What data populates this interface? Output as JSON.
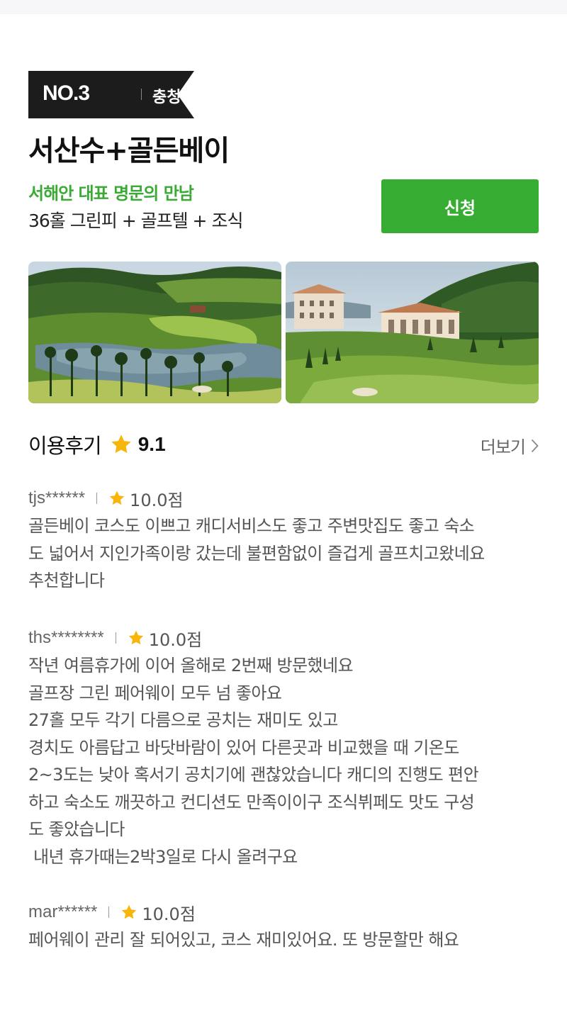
{
  "product": {
    "rank": "NO.3",
    "region": "충청",
    "title": "서산수+골든베이",
    "subtitle": "서해안 대표 명문의 만남",
    "package": "36홀 그린피 + 골프텔 + 조식",
    "apply_label": "신청"
  },
  "photos": [
    {
      "icon": "golf-course-aerial-photo"
    },
    {
      "icon": "clubhouse-resort-photo"
    }
  ],
  "reviews": {
    "title": "이용후기",
    "average": "9.1",
    "more_label": "더보기",
    "items": [
      {
        "user": "tjs******",
        "score": "10.0점",
        "text": "골든베이 코스도 이쁘고 캐디서비스도 좋고 주변맛집도 좋고 숙소\n도 넓어서 지인가족이랑 갔는데 불편함없이 즐겁게 골프치고왔네요\n추천합니다"
      },
      {
        "user": "ths********",
        "score": "10.0점",
        "text": "작년 여름휴가에 이어 올해로 2번째 방문했네요\n골프장 그린 페어웨이 모두 넘 좋아요\n27홀 모두 각기 다름으로 공치는 재미도 있고\n경치도 아름답고 바닷바람이 있어 다른곳과 비교했을 때 기온도\n2~3도는 낮아 혹서기 공치기에 괜찮았습니다 캐디의 진행도 편안\n하고 숙소도 깨끗하고 컨디션도 만족이이구 조식뷔페도 맛도 구성\n도 좋았습니다\n 내년 휴가때는2박3일로 다시 올려구요"
      },
      {
        "user": "mar******",
        "score": "10.0점",
        "text": "페어웨이 관리 잘 되어있고, 코스 재미있어요. 또 방문할만 해요"
      }
    ]
  },
  "colors": {
    "accent_green": "#36ad32",
    "subtitle_green": "#3aaa35",
    "star_yellow": "#f8b60b",
    "badge_black": "#1c1c1c"
  }
}
